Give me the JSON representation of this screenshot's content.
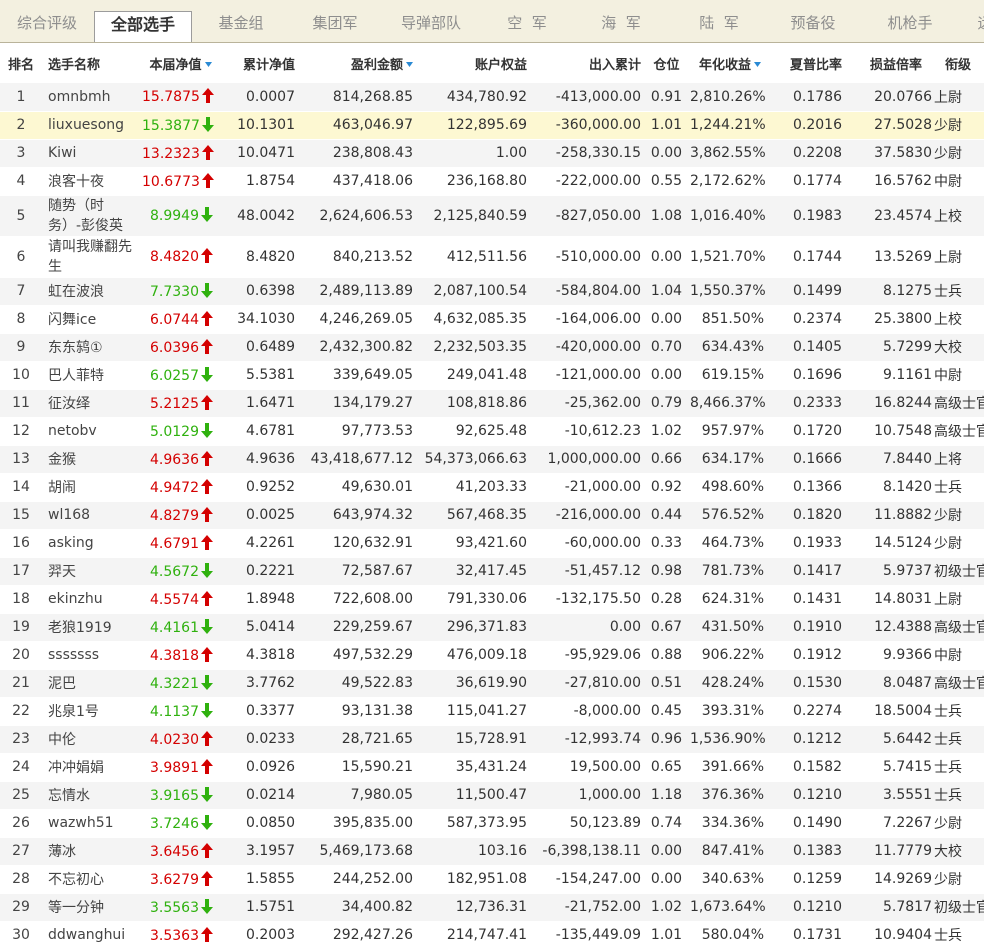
{
  "tabs": [
    {
      "label": "综合评级",
      "active": false
    },
    {
      "label": "全部选手",
      "active": true
    },
    {
      "label": "基金组",
      "active": false
    },
    {
      "label": "集团军",
      "active": false
    },
    {
      "label": "导弹部队",
      "active": false
    },
    {
      "label": "空  军",
      "active": false
    },
    {
      "label": "海  军",
      "active": false
    },
    {
      "label": "陆  军",
      "active": false
    },
    {
      "label": "预备役",
      "active": false
    },
    {
      "label": "机枪手",
      "active": false
    },
    {
      "label": "远",
      "active": false
    }
  ],
  "columns": {
    "rank": "排名",
    "name": "选手名称",
    "nav": "本届净值",
    "cum_nav": "累计净值",
    "profit": "盈利金额",
    "equity": "账户权益",
    "inout": "出入累计",
    "position": "仓位",
    "annual": "年化收益",
    "sharpe": "夏普比率",
    "pl_ratio": "损益倍率",
    "title": "衔级"
  },
  "sortable_columns": [
    "nav",
    "profit",
    "annual"
  ],
  "colors": {
    "up": "#d40000",
    "down": "#2fb10e",
    "row_alt": "#f4f4f4",
    "row_selected": "#fdf8d2",
    "tab_bar": "#f3f0e0"
  },
  "selected_row_rank": "2",
  "rows": [
    {
      "rank": "1",
      "name": "omnbmh",
      "nav": "15.7875",
      "dir": "up",
      "cum_nav": "0.0007",
      "profit": "814,268.85",
      "equity": "434,780.92",
      "inout": "-413,000.00",
      "position": "0.91",
      "annual": "2,810.26%",
      "sharpe": "0.1786",
      "pl_ratio": "20.0766",
      "title": "上尉"
    },
    {
      "rank": "2",
      "name": "liuxuesong",
      "nav": "15.3877",
      "dir": "down",
      "cum_nav": "10.1301",
      "profit": "463,046.97",
      "equity": "122,895.69",
      "inout": "-360,000.00",
      "position": "1.01",
      "annual": "1,244.21%",
      "sharpe": "0.2016",
      "pl_ratio": "27.5028",
      "title": "少尉"
    },
    {
      "rank": "3",
      "name": "Kiwi",
      "nav": "13.2323",
      "dir": "up",
      "cum_nav": "10.0471",
      "profit": "238,808.43",
      "equity": "1.00",
      "inout": "-258,330.15",
      "position": "0.00",
      "annual": "3,862.55%",
      "sharpe": "0.2208",
      "pl_ratio": "37.5830",
      "title": "少尉"
    },
    {
      "rank": "4",
      "name": "浪客十夜",
      "nav": "10.6773",
      "dir": "up",
      "cum_nav": "1.8754",
      "profit": "437,418.06",
      "equity": "236,168.80",
      "inout": "-222,000.00",
      "position": "0.55",
      "annual": "2,172.62%",
      "sharpe": "0.1774",
      "pl_ratio": "16.5762",
      "title": "中尉"
    },
    {
      "rank": "5",
      "name": "随势（时务）-彭俊英",
      "nav": "8.9949",
      "dir": "down",
      "cum_nav": "48.0042",
      "profit": "2,624,606.53",
      "equity": "2,125,840.59",
      "inout": "-827,050.00",
      "position": "1.08",
      "annual": "1,016.40%",
      "sharpe": "0.1983",
      "pl_ratio": "23.4574",
      "title": "上校",
      "tall": true
    },
    {
      "rank": "6",
      "name": "请叫我赚翻先生",
      "nav": "8.4820",
      "dir": "up",
      "cum_nav": "8.4820",
      "profit": "840,213.52",
      "equity": "412,511.56",
      "inout": "-510,000.00",
      "position": "0.00",
      "annual": "1,521.70%",
      "sharpe": "0.1744",
      "pl_ratio": "13.5269",
      "title": "上尉",
      "tall": true
    },
    {
      "rank": "7",
      "name": "虹在波浪",
      "nav": "7.7330",
      "dir": "down",
      "cum_nav": "0.6398",
      "profit": "2,489,113.89",
      "equity": "2,087,100.54",
      "inout": "-584,804.00",
      "position": "1.04",
      "annual": "1,550.37%",
      "sharpe": "0.1499",
      "pl_ratio": "8.1275",
      "title": "士兵"
    },
    {
      "rank": "8",
      "name": "闪舞ice",
      "nav": "6.0744",
      "dir": "up",
      "cum_nav": "34.1030",
      "profit": "4,246,269.05",
      "equity": "4,632,085.35",
      "inout": "-164,006.00",
      "position": "0.00",
      "annual": "851.50%",
      "sharpe": "0.2374",
      "pl_ratio": "25.3800",
      "title": "上校"
    },
    {
      "rank": "9",
      "name": "东东鸫①",
      "nav": "6.0396",
      "dir": "up",
      "cum_nav": "0.6489",
      "profit": "2,432,300.82",
      "equity": "2,232,503.35",
      "inout": "-420,000.00",
      "position": "0.70",
      "annual": "634.43%",
      "sharpe": "0.1405",
      "pl_ratio": "5.7299",
      "title": "大校"
    },
    {
      "rank": "10",
      "name": "巴人菲特",
      "nav": "6.0257",
      "dir": "down",
      "cum_nav": "5.5381",
      "profit": "339,649.05",
      "equity": "249,041.48",
      "inout": "-121,000.00",
      "position": "0.00",
      "annual": "619.15%",
      "sharpe": "0.1696",
      "pl_ratio": "9.1161",
      "title": "中尉"
    },
    {
      "rank": "11",
      "name": "征汝绎",
      "nav": "5.2125",
      "dir": "up",
      "cum_nav": "1.6471",
      "profit": "134,179.27",
      "equity": "108,818.86",
      "inout": "-25,362.00",
      "position": "0.79",
      "annual": "8,466.37%",
      "sharpe": "0.2333",
      "pl_ratio": "16.8244",
      "title": "高级士官"
    },
    {
      "rank": "12",
      "name": "netobv",
      "nav": "5.0129",
      "dir": "down",
      "cum_nav": "4.6781",
      "profit": "97,773.53",
      "equity": "92,625.48",
      "inout": "-10,612.23",
      "position": "1.02",
      "annual": "957.97%",
      "sharpe": "0.1720",
      "pl_ratio": "10.7548",
      "title": "高级士官"
    },
    {
      "rank": "13",
      "name": "金猴",
      "nav": "4.9636",
      "dir": "up",
      "cum_nav": "4.9636",
      "profit": "43,418,677.12",
      "equity": "54,373,066.63",
      "inout": "1,000,000.00",
      "position": "0.66",
      "annual": "634.17%",
      "sharpe": "0.1666",
      "pl_ratio": "7.8440",
      "title": "上将"
    },
    {
      "rank": "14",
      "name": "胡闹",
      "nav": "4.9472",
      "dir": "up",
      "cum_nav": "0.9252",
      "profit": "49,630.01",
      "equity": "41,203.33",
      "inout": "-21,000.00",
      "position": "0.92",
      "annual": "498.60%",
      "sharpe": "0.1366",
      "pl_ratio": "8.1420",
      "title": "士兵"
    },
    {
      "rank": "15",
      "name": "wl168",
      "nav": "4.8279",
      "dir": "up",
      "cum_nav": "0.0025",
      "profit": "643,974.32",
      "equity": "567,468.35",
      "inout": "-216,000.00",
      "position": "0.44",
      "annual": "576.52%",
      "sharpe": "0.1820",
      "pl_ratio": "11.8882",
      "title": "少尉"
    },
    {
      "rank": "16",
      "name": "asking",
      "nav": "4.6791",
      "dir": "up",
      "cum_nav": "4.2261",
      "profit": "120,632.91",
      "equity": "93,421.60",
      "inout": "-60,000.00",
      "position": "0.33",
      "annual": "464.73%",
      "sharpe": "0.1933",
      "pl_ratio": "14.5124",
      "title": "少尉"
    },
    {
      "rank": "17",
      "name": "羿天",
      "nav": "4.5672",
      "dir": "down",
      "cum_nav": "0.2221",
      "profit": "72,587.67",
      "equity": "32,417.45",
      "inout": "-51,457.12",
      "position": "0.98",
      "annual": "781.73%",
      "sharpe": "0.1417",
      "pl_ratio": "5.9737",
      "title": "初级士官"
    },
    {
      "rank": "18",
      "name": "ekinzhu",
      "nav": "4.5574",
      "dir": "up",
      "cum_nav": "1.8948",
      "profit": "722,608.00",
      "equity": "791,330.06",
      "inout": "-132,175.50",
      "position": "0.28",
      "annual": "624.31%",
      "sharpe": "0.1431",
      "pl_ratio": "14.8031",
      "title": "上尉"
    },
    {
      "rank": "19",
      "name": "老狼1919",
      "nav": "4.4161",
      "dir": "down",
      "cum_nav": "5.0414",
      "profit": "229,259.67",
      "equity": "296,371.83",
      "inout": "0.00",
      "position": "0.67",
      "annual": "431.50%",
      "sharpe": "0.1910",
      "pl_ratio": "12.4388",
      "title": "高级士官"
    },
    {
      "rank": "20",
      "name": "sssssss",
      "nav": "4.3818",
      "dir": "up",
      "cum_nav": "4.3818",
      "profit": "497,532.29",
      "equity": "476,009.18",
      "inout": "-95,929.06",
      "position": "0.88",
      "annual": "906.22%",
      "sharpe": "0.1912",
      "pl_ratio": "9.9366",
      "title": "中尉"
    },
    {
      "rank": "21",
      "name": "泥巴",
      "nav": "4.3221",
      "dir": "down",
      "cum_nav": "3.7762",
      "profit": "49,522.83",
      "equity": "36,619.90",
      "inout": "-27,810.00",
      "position": "0.51",
      "annual": "428.24%",
      "sharpe": "0.1530",
      "pl_ratio": "8.0487",
      "title": "高级士官"
    },
    {
      "rank": "22",
      "name": "兆泉1号",
      "nav": "4.1137",
      "dir": "down",
      "cum_nav": "0.3377",
      "profit": "93,131.38",
      "equity": "115,041.27",
      "inout": "-8,000.00",
      "position": "0.45",
      "annual": "393.31%",
      "sharpe": "0.2274",
      "pl_ratio": "18.5004",
      "title": "士兵"
    },
    {
      "rank": "23",
      "name": "中伦",
      "nav": "4.0230",
      "dir": "up",
      "cum_nav": "0.0233",
      "profit": "28,721.65",
      "equity": "15,728.91",
      "inout": "-12,993.74",
      "position": "0.96",
      "annual": "1,536.90%",
      "sharpe": "0.1212",
      "pl_ratio": "5.6442",
      "title": "士兵"
    },
    {
      "rank": "24",
      "name": "冲冲娟娟",
      "nav": "3.9891",
      "dir": "up",
      "cum_nav": "0.0926",
      "profit": "15,590.21",
      "equity": "35,431.24",
      "inout": "19,500.00",
      "position": "0.65",
      "annual": "391.66%",
      "sharpe": "0.1582",
      "pl_ratio": "5.7415",
      "title": "士兵"
    },
    {
      "rank": "25",
      "name": "忘情水",
      "nav": "3.9165",
      "dir": "down",
      "cum_nav": "0.0214",
      "profit": "7,980.05",
      "equity": "11,500.47",
      "inout": "1,000.00",
      "position": "1.18",
      "annual": "376.36%",
      "sharpe": "0.1210",
      "pl_ratio": "3.5551",
      "title": "士兵"
    },
    {
      "rank": "26",
      "name": "wazwh51",
      "nav": "3.7246",
      "dir": "down",
      "cum_nav": "0.0850",
      "profit": "395,835.00",
      "equity": "587,373.95",
      "inout": "50,123.89",
      "position": "0.74",
      "annual": "334.36%",
      "sharpe": "0.1490",
      "pl_ratio": "7.2267",
      "title": "少尉"
    },
    {
      "rank": "27",
      "name": "薄冰",
      "nav": "3.6456",
      "dir": "up",
      "cum_nav": "3.1957",
      "profit": "5,469,173.68",
      "equity": "103.16",
      "inout": "-6,398,138.11",
      "position": "0.00",
      "annual": "847.41%",
      "sharpe": "0.1383",
      "pl_ratio": "11.7779",
      "title": "大校"
    },
    {
      "rank": "28",
      "name": "不忘初心",
      "nav": "3.6279",
      "dir": "up",
      "cum_nav": "1.5855",
      "profit": "244,252.00",
      "equity": "182,951.08",
      "inout": "-154,247.00",
      "position": "0.00",
      "annual": "340.63%",
      "sharpe": "0.1259",
      "pl_ratio": "14.9269",
      "title": "少尉"
    },
    {
      "rank": "29",
      "name": "等一分钟",
      "nav": "3.5563",
      "dir": "down",
      "cum_nav": "1.5751",
      "profit": "34,400.82",
      "equity": "12,736.31",
      "inout": "-21,752.00",
      "position": "1.02",
      "annual": "1,673.64%",
      "sharpe": "0.1210",
      "pl_ratio": "5.7817",
      "title": "初级士官"
    },
    {
      "rank": "30",
      "name": "ddwanghui",
      "nav": "3.5363",
      "dir": "up",
      "cum_nav": "0.2003",
      "profit": "292,427.26",
      "equity": "214,747.41",
      "inout": "-135,449.09",
      "position": "1.01",
      "annual": "580.04%",
      "sharpe": "0.1731",
      "pl_ratio": "10.9404",
      "title": "士兵"
    }
  ]
}
